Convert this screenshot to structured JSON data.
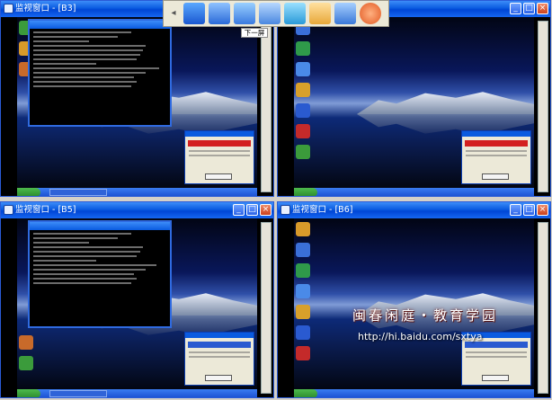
{
  "panes": [
    {
      "title": "监视窗口 - [B3]",
      "has_console": true,
      "has_page_button": true
    },
    {
      "title": "",
      "has_console": false,
      "has_page_button": false
    },
    {
      "title": "监视窗口 - [B5]",
      "has_console": true,
      "has_page_button": false
    },
    {
      "title": "监视窗口 - [B6]",
      "has_console": false,
      "has_page_button": false
    }
  ],
  "window_buttons": {
    "minimize": "_",
    "restore": "□",
    "close": "×"
  },
  "page_button_label": "下一屏",
  "toolbar": {
    "arrow_left": "◂",
    "icons": [
      "monitor-icon",
      "multi-screen-icon",
      "transfer-icon",
      "single-screen-icon",
      "refresh-icon",
      "hand-icon",
      "fullscreen-icon",
      "stop-icon"
    ]
  },
  "watermark": {
    "text": "闽春闲庭・教育学园",
    "url": "http://hi.baidu.com/sxtya"
  },
  "colors": {
    "titlebar": "#0a5be0",
    "close": "#c9401c",
    "stop": "#e25a23",
    "desktop": "#09175a"
  }
}
